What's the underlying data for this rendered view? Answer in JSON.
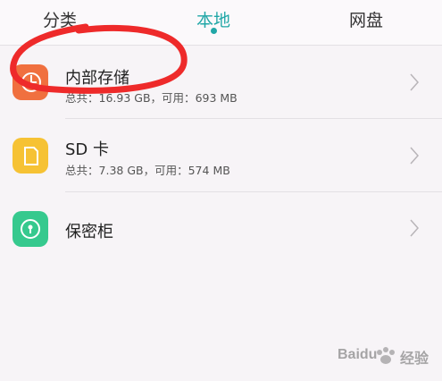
{
  "tabs": [
    {
      "label": "分类",
      "active": false
    },
    {
      "label": "本地",
      "active": true
    },
    {
      "label": "网盘",
      "active": false
    }
  ],
  "accent_color": "#21a7a7",
  "storage": [
    {
      "title": "内部存储",
      "total_label": "总共：",
      "total_value": "16.93 GB",
      "available_label": "，可用：",
      "available_value": "693 MB",
      "icon": "pie-chart-icon",
      "color": "#f0703f"
    },
    {
      "title": "SD 卡",
      "total_label": "总共：",
      "total_value": "7.38 GB",
      "available_label": "，可用：",
      "available_value": "574 MB",
      "icon": "sd-card-icon",
      "color": "#f6c234"
    },
    {
      "title": "保密柜",
      "icon": "safe-lock-icon",
      "color": "#36c98e"
    }
  ],
  "watermark": {
    "brand": "Baidu",
    "text": "经验"
  }
}
